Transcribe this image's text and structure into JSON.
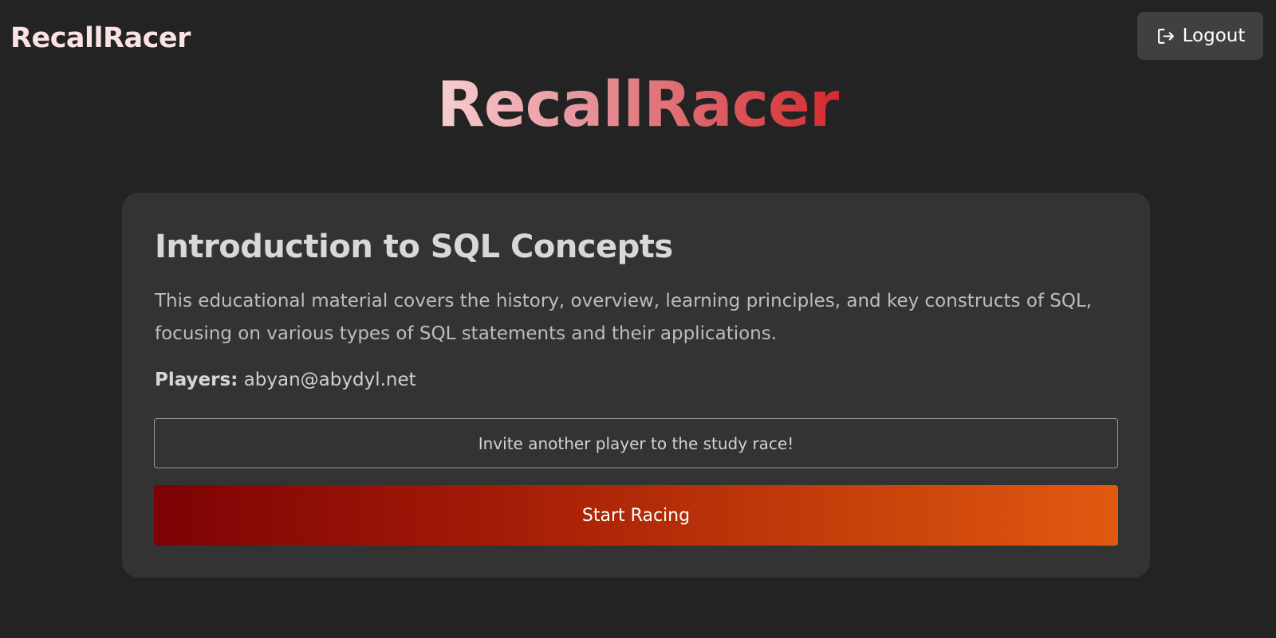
{
  "header": {
    "brand": "RecallRacer",
    "logout_label": "Logout",
    "logout_icon": "logout-icon"
  },
  "hero": {
    "title": "RecallRacer"
  },
  "race_card": {
    "title": "Introduction to SQL Concepts",
    "description": "This educational material covers the history, overview, learning principles, and key constructs of SQL, focusing on various types of SQL statements and their applications.",
    "players_label": "Players:",
    "players_value": "abyan@abydyl.net",
    "invite_label": "Invite another player to the study race!",
    "start_label": "Start Racing"
  },
  "colors": {
    "background": "#232323",
    "card": "#333333",
    "brand": "#fbe3e3",
    "start_gradient_from": "#7d0205",
    "start_gradient_to": "#e25910",
    "hero_gradient_from": "#f7cfd0",
    "hero_gradient_to": "#d42a2e"
  }
}
